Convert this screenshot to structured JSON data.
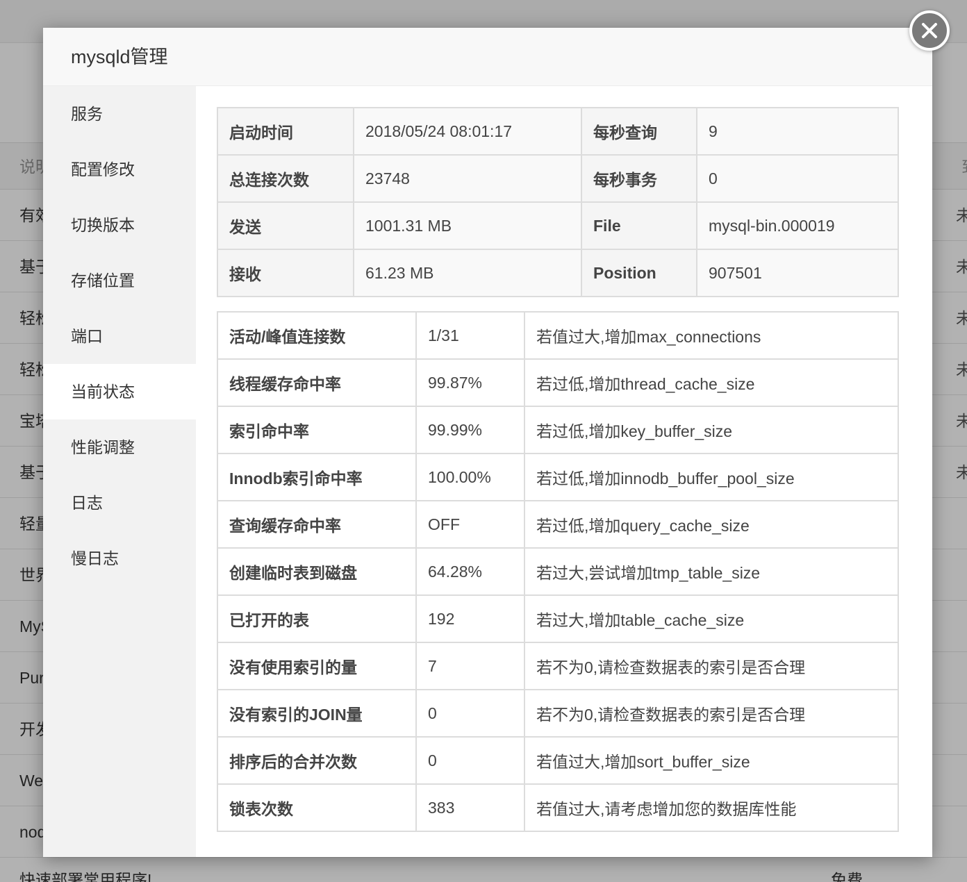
{
  "background": {
    "header_left": "说明",
    "header_right": "到",
    "rows": [
      {
        "left": "有效",
        "right": "未"
      },
      {
        "left": "基于",
        "right": "未"
      },
      {
        "left": "轻松",
        "right": "未"
      },
      {
        "left": "轻松",
        "right": "未"
      },
      {
        "left": "宝塔",
        "right": "未"
      },
      {
        "left": "基于",
        "right": "未"
      },
      {
        "left": "轻量",
        "right": ""
      },
      {
        "left": "世界",
        "right": ""
      },
      {
        "left": "MySQL",
        "right": ""
      },
      {
        "left": "Pure",
        "right": ""
      },
      {
        "left": "开发",
        "right": ""
      },
      {
        "left": "Web",
        "right": ""
      },
      {
        "left": "node",
        "right": ""
      }
    ],
    "last_row_left": "快速部署常用程序!",
    "last_row_right": "免费"
  },
  "modal": {
    "title": "mysqld管理",
    "sidebar": [
      "服务",
      "配置修改",
      "切换版本",
      "存储位置",
      "端口",
      "当前状态",
      "性能调整",
      "日志",
      "慢日志"
    ],
    "active_index": 5,
    "info_table": [
      {
        "l1": "启动时间",
        "v1": "2018/05/24 08:01:17",
        "l2": "每秒查询",
        "v2": "9"
      },
      {
        "l1": "总连接次数",
        "v1": "23748",
        "l2": "每秒事务",
        "v2": "0"
      },
      {
        "l1": "发送",
        "v1": "1001.31 MB",
        "l2": "File",
        "v2": "mysql-bin.000019"
      },
      {
        "l1": "接收",
        "v1": "61.23 MB",
        "l2": "Position",
        "v2": "907501"
      }
    ],
    "status_table": [
      {
        "name": "活动/峰值连接数",
        "value": "1/31",
        "tip": "若值过大,增加max_connections"
      },
      {
        "name": "线程缓存命中率",
        "value": "99.87%",
        "tip": "若过低,增加thread_cache_size"
      },
      {
        "name": "索引命中率",
        "value": "99.99%",
        "tip": "若过低,增加key_buffer_size"
      },
      {
        "name": "Innodb索引命中率",
        "value": "100.00%",
        "tip": "若过低,增加innodb_buffer_pool_size"
      },
      {
        "name": "查询缓存命中率",
        "value": "OFF",
        "tip": "若过低,增加query_cache_size"
      },
      {
        "name": "创建临时表到磁盘",
        "value": "64.28%",
        "tip": "若过大,尝试增加tmp_table_size"
      },
      {
        "name": "已打开的表",
        "value": "192",
        "tip": "若过大,增加table_cache_size"
      },
      {
        "name": "没有使用索引的量",
        "value": "7",
        "tip": "若不为0,请检查数据表的索引是否合理"
      },
      {
        "name": "没有索引的JOIN量",
        "value": "0",
        "tip": "若不为0,请检查数据表的索引是否合理"
      },
      {
        "name": "排序后的合并次数",
        "value": "0",
        "tip": "若值过大,增加sort_buffer_size"
      },
      {
        "name": "锁表次数",
        "value": "383",
        "tip": "若值过大,请考虑增加您的数据库性能"
      }
    ]
  },
  "icons": {
    "close": "close-icon"
  }
}
